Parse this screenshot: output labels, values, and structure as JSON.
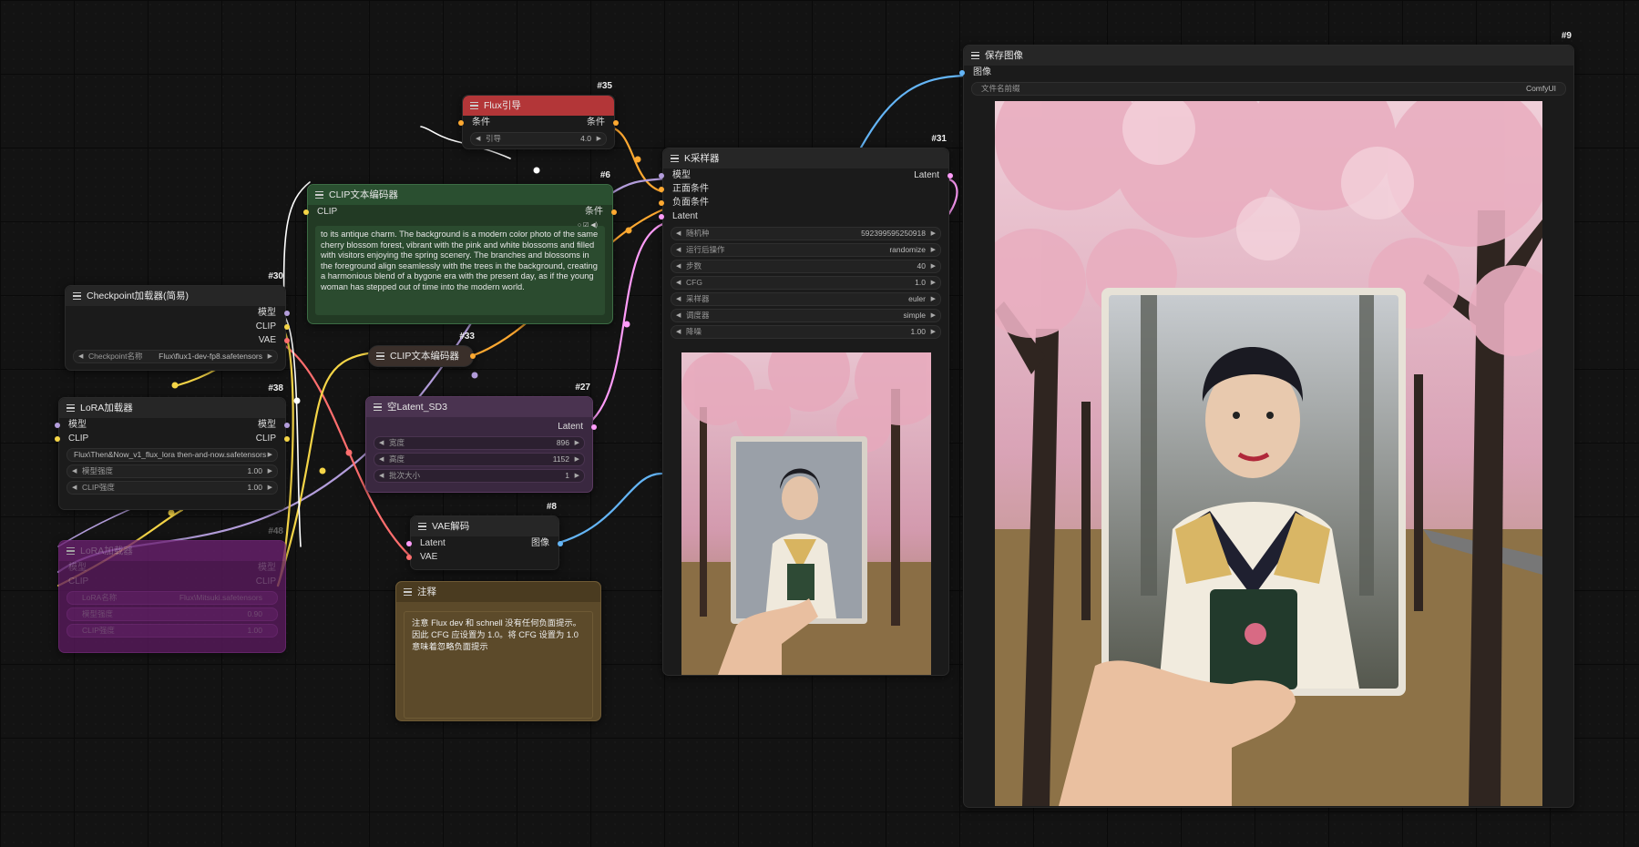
{
  "colors": {
    "model": "#b39ddb",
    "clip": "#f5d547",
    "vae": "#ff6e6e",
    "conditioning": "#ffa931",
    "latent": "#ff9cf9",
    "image": "#64b5f6"
  },
  "nodes": {
    "flux_guidance": {
      "id": "#35",
      "title": "Flux引导",
      "in_label": "条件",
      "out_label": "条件",
      "w1_label": "引导",
      "w1_value": "4.0"
    },
    "clip_encoder": {
      "id": "#6",
      "title": "CLIP文本编码器",
      "in_label": "CLIP",
      "out_label": "条件",
      "text": "to its antique charm. The background is a modern color photo of the same cherry blossom forest, vibrant with the pink and white blossoms and filled with visitors enjoying the spring scenery. The branches and blossoms in the foreground align seamlessly with the trees in the background, creating a harmonious blend of a bygone era with the present day, as if the young woman has stepped out of time into the modern world."
    },
    "checkpoint": {
      "id": "#30",
      "title": "Checkpoint加载器(简易)",
      "out1": "模型",
      "out2": "CLIP",
      "out3": "VAE",
      "w1_label": "Checkpoint名称",
      "w1_value": "Flux\\flux1-dev-fp8.safetensors"
    },
    "clip_encoder_collapsed": {
      "id": "#33",
      "title": "CLIP文本编码器"
    },
    "lora": {
      "id": "#38",
      "title": "LoRA加载器",
      "in1": "模型",
      "in2": "CLIP",
      "out1": "模型",
      "out2": "CLIP",
      "w1_label": "Flux\\Then&Now_v1_flux_lora then-and-now.safetensors",
      "w2_label": "模型强度",
      "w2_value": "1.00",
      "w3_label": "CLIP强度",
      "w3_value": "1.00"
    },
    "lora_bypassed": {
      "id": "#48",
      "title": "LoRA加载器",
      "in1": "模型",
      "in2": "CLIP",
      "out1": "模型",
      "out2": "CLIP",
      "w1_label": "LoRA名称",
      "w1_value": "Flux\\Mitsuki.safetensors",
      "w2_label": "模型强度",
      "w2_value": "0.90",
      "w3_label": "CLIP强度",
      "w3_value": "1.00"
    },
    "empty_latent": {
      "id": "#27",
      "title": "空Latent_SD3",
      "out_label": "Latent",
      "w1_label": "宽度",
      "w1_value": "896",
      "w2_label": "高度",
      "w2_value": "1152",
      "w3_label": "批次大小",
      "w3_value": "1"
    },
    "vae_decode": {
      "id": "#8",
      "title": "VAE解码",
      "in1": "Latent",
      "in2": "VAE",
      "out_label": "图像"
    },
    "note": {
      "title": "注释",
      "text": "注意 Flux dev 和 schnell 没有任何负面提示。因此 CFG 应设置为 1.0。将 CFG 设置为 1.0 意味着忽略负面提示"
    },
    "ksampler": {
      "id": "#31",
      "title": "K采样器",
      "in1": "模型",
      "in2": "正面条件",
      "in3": "负面条件",
      "in4": "Latent",
      "out_label": "Latent",
      "widgets": [
        {
          "label": "随机种",
          "value": "592399595250918"
        },
        {
          "label": "运行后操作",
          "value": "randomize"
        },
        {
          "label": "步数",
          "value": "40"
        },
        {
          "label": "CFG",
          "value": "1.0"
        },
        {
          "label": "采样器",
          "value": "euler"
        },
        {
          "label": "调度器",
          "value": "simple"
        },
        {
          "label": "降噪",
          "value": "1.00"
        }
      ]
    },
    "save_image": {
      "id": "#9",
      "title": "保存图像",
      "in_label": "图像",
      "w1_label": "文件名前缀",
      "w1_value": "ComfyUI"
    }
  }
}
